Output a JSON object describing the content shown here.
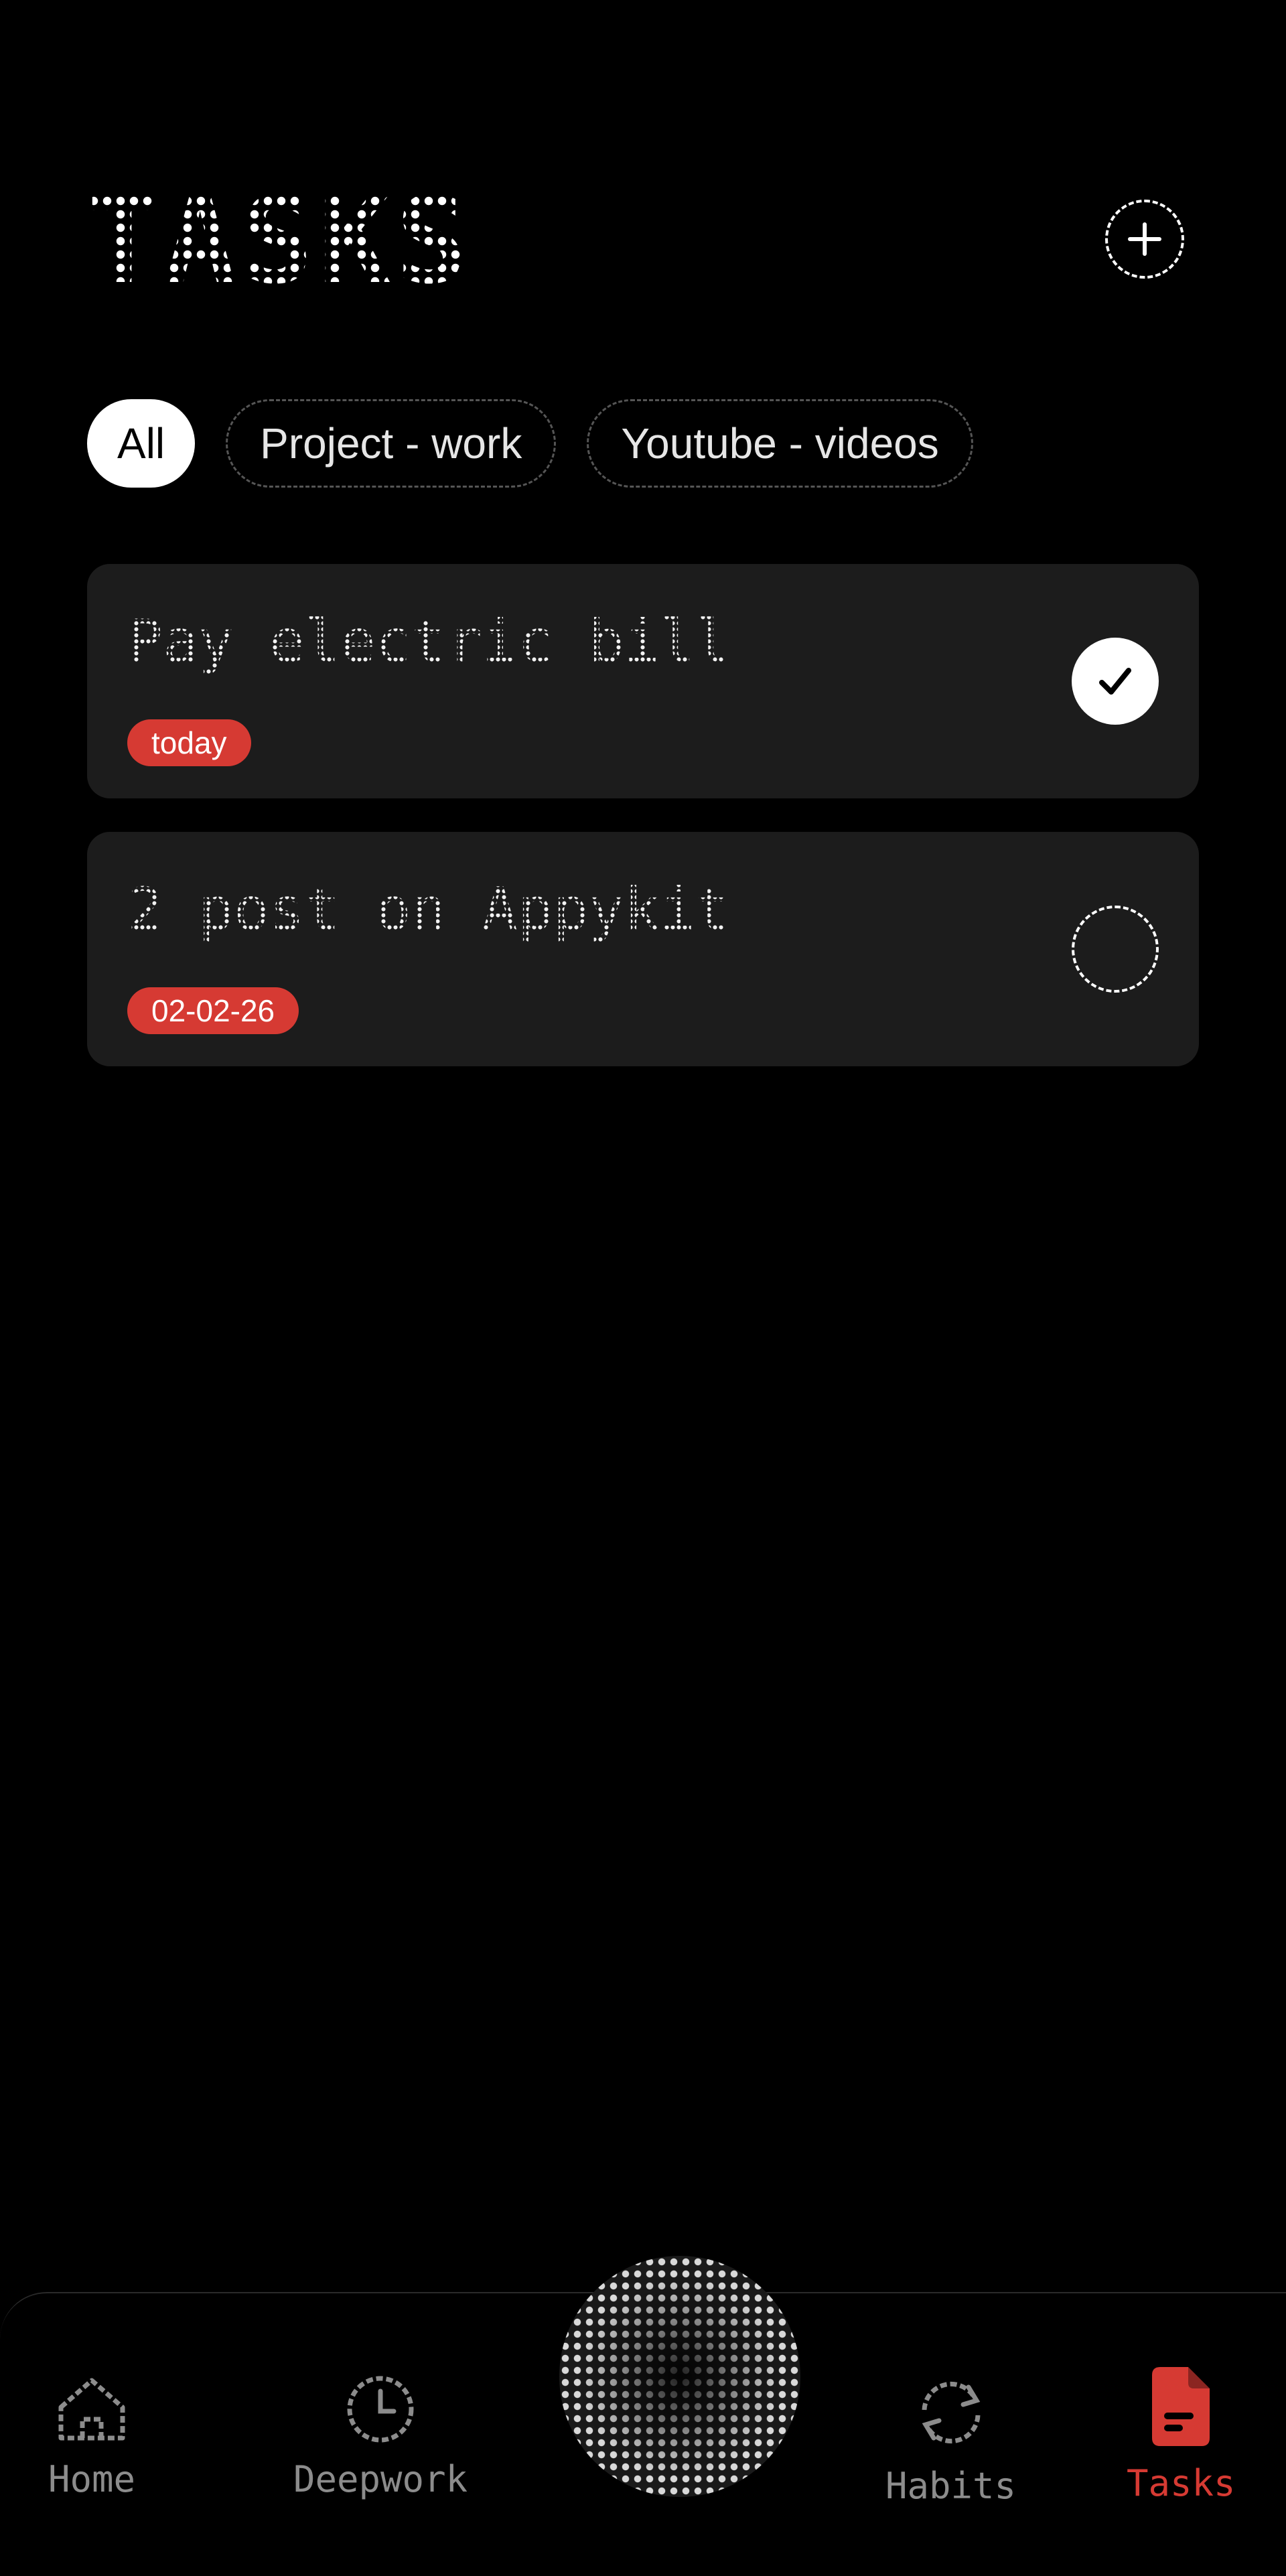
{
  "header": {
    "title": "TASKS"
  },
  "filters": [
    {
      "label": "All",
      "active": true
    },
    {
      "label": "Project - work",
      "active": false
    },
    {
      "label": "Youtube - videos",
      "active": false
    }
  ],
  "tasks": [
    {
      "title": "Pay electric bill",
      "badge": "today",
      "done": true
    },
    {
      "title": "2 post on Appykit",
      "badge": "02-02-26",
      "done": false
    }
  ],
  "nav": {
    "home": "Home",
    "deepwork": "Deepwork",
    "habits": "Habits",
    "tasks": "Tasks"
  },
  "colors": {
    "accent": "#d63a33",
    "card": "#1c1c1c",
    "background": "#000000"
  }
}
